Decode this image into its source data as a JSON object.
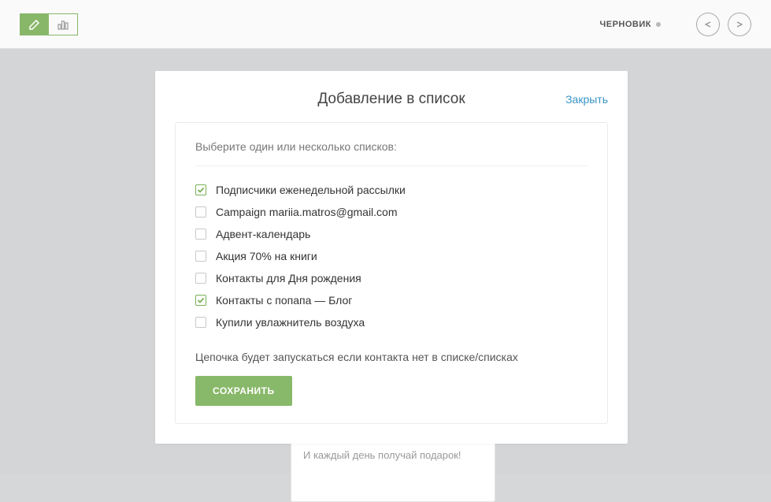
{
  "topbar": {
    "status": "ЧЕРНОВИК"
  },
  "modal": {
    "title": "Добавление в список",
    "close": "Закрыть",
    "subtitle": "Выберите один или несколько списков:",
    "items": [
      {
        "label": "Подписчики еженедельной рассылки",
        "checked": true
      },
      {
        "label": "Campaign mariia.matros@gmail.com",
        "checked": false
      },
      {
        "label": "Адвент-календарь",
        "checked": false
      },
      {
        "label": "Акция 70% на книги",
        "checked": false
      },
      {
        "label": "Контакты для Дня рождения",
        "checked": false
      },
      {
        "label": "Контакты с попапа — Блог",
        "checked": true
      },
      {
        "label": "Купили увлажнитель воздуха",
        "checked": false
      }
    ],
    "note": "Цепочка будет запускаться если контакта нет в списке/списках",
    "save": "СОХРАНИТЬ"
  },
  "bg_card": {
    "text": "И каждый день получай подарок!"
  }
}
